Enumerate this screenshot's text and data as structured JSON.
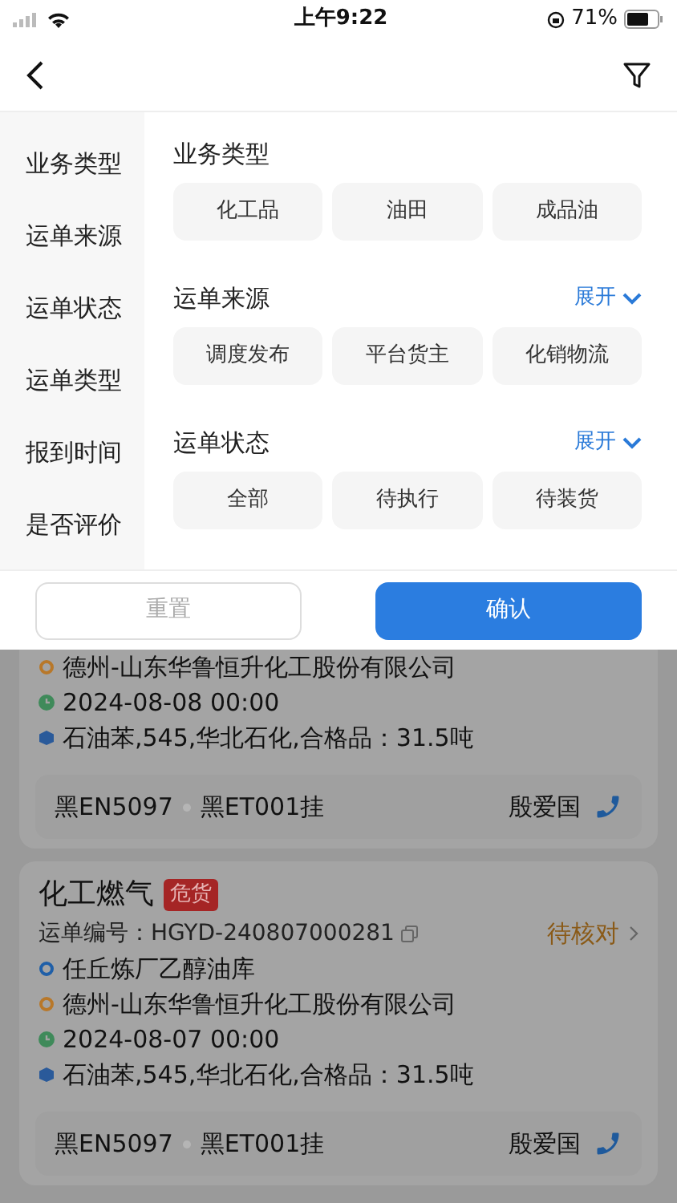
{
  "status_bar": {
    "time": "上午9:22",
    "battery": "71%"
  },
  "filter": {
    "sidebar": [
      "业务类型",
      "运单来源",
      "运单状态",
      "运单类型",
      "报到时间",
      "是否评价"
    ],
    "sections": [
      {
        "title": "业务类型",
        "options": [
          "化工品",
          "油田",
          "成品油"
        ]
      },
      {
        "title": "运单来源",
        "expand": "展开",
        "options": [
          "调度发布",
          "平台货主",
          "化销物流"
        ]
      },
      {
        "title": "运单状态",
        "expand": "展开",
        "options": [
          "全部",
          "待执行",
          "待装货"
        ]
      }
    ],
    "buttons": {
      "reset": "重置",
      "confirm": "确认"
    }
  },
  "orders": [
    {
      "lines": [
        {
          "kind": "destination",
          "text": "德州-山东华鲁恒升化工股份有限公司"
        },
        {
          "kind": "time",
          "text": "2024-08-08 00:00"
        },
        {
          "kind": "cargo",
          "text": "石油苯,545,华北石化,合格品：31.5吨"
        }
      ],
      "plate": "黑EN5097",
      "trailer": "黑ET001挂",
      "driver": "殷爱国"
    },
    {
      "title": "化工燃气",
      "tag": "危货",
      "status": "待核对",
      "order_no": "运单编号：HGYD-240807000281",
      "lines": [
        {
          "kind": "origin",
          "text": "任丘炼厂乙醇油库"
        },
        {
          "kind": "destination",
          "text": "德州-山东华鲁恒升化工股份有限公司"
        },
        {
          "kind": "time",
          "text": "2024-08-07 00:00"
        },
        {
          "kind": "cargo",
          "text": "石油苯,545,华北石化,合格品：31.5吨"
        }
      ],
      "plate": "黑EN5097",
      "trailer": "黑ET001挂",
      "driver": "殷爱国"
    }
  ]
}
